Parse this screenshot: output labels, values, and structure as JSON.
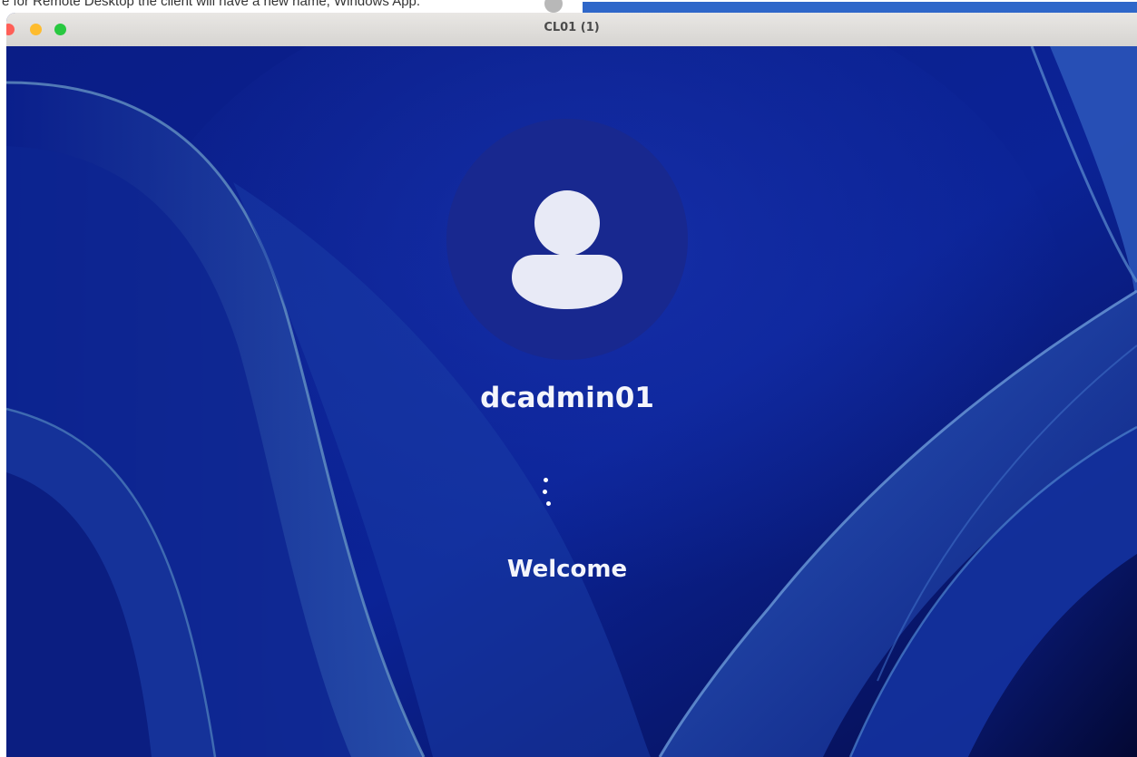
{
  "background_window": {
    "partial_text": "e for Remote Desktop the client will have a new name, Windows App."
  },
  "window": {
    "title": "CL01 (1)",
    "traffic_lights": [
      "close",
      "minimize",
      "maximize"
    ]
  },
  "login_screen": {
    "avatar_icon": "person-icon",
    "username": "dcadmin01",
    "status": "Welcome",
    "spinner_icon": "loading-dots-icon"
  },
  "colors": {
    "wallpaper_dark": "#07146e",
    "wallpaper_mid": "#0d2aa3",
    "ribbon_light": "#3a62b8",
    "avatar_bg": "#18288f",
    "text": "#f4f5fb"
  }
}
